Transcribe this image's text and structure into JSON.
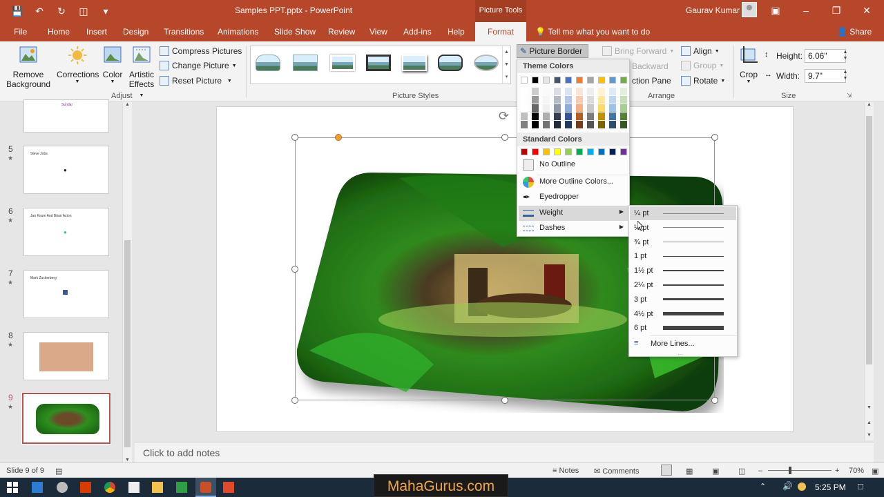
{
  "app": {
    "doc_title": "Samples PPT.pptx  -  PowerPoint",
    "context_tools": "Picture Tools",
    "user": "Gaurav Kumar"
  },
  "tabs": {
    "file": "File",
    "home": "Home",
    "insert": "Insert",
    "design": "Design",
    "transitions": "Transitions",
    "animations": "Animations",
    "slideshow": "Slide Show",
    "review": "Review",
    "view": "View",
    "addins": "Add-ins",
    "help": "Help",
    "format": "Format",
    "tell": "Tell me what you want to do",
    "share": "Share"
  },
  "ribbon": {
    "remove_bg_1": "Remove",
    "remove_bg_2": "Background",
    "corrections": "Corrections",
    "color": "Color",
    "artistic_1": "Artistic",
    "artistic_2": "Effects",
    "compress": "Compress Pictures",
    "change": "Change Picture",
    "reset": "Reset Picture",
    "adjust_label": "Adjust",
    "styles_label": "Picture Styles",
    "picture_border": "Picture Border",
    "bring_forward": "Bring Forward",
    "send_backward": "Backward",
    "selection_pane": "ction Pane",
    "align": "Align",
    "group": "Group",
    "rotate": "Rotate",
    "arrange_label": "Arrange",
    "crop": "Crop",
    "height_label": "Height:",
    "height_value": "6.06\"",
    "width_label": "Width:",
    "width_value": "9.7\"",
    "size_label": "Size"
  },
  "border_menu": {
    "theme_colors": "Theme Colors",
    "standard_colors": "Standard Colors",
    "no_outline": "No Outline",
    "more_colors": "More Outline Colors...",
    "eyedropper": "Eyedropper",
    "weight": "Weight",
    "dashes": "Dashes",
    "theme_row": [
      "#ffffff",
      "#000000",
      "#e7e6e6",
      "#44546a",
      "#4472c4",
      "#ed7d31",
      "#a5a5a5",
      "#ffc000",
      "#5b9bd5",
      "#70ad47"
    ],
    "standard_row": [
      "#c00000",
      "#ff0000",
      "#ffc000",
      "#ffff00",
      "#92d050",
      "#00b050",
      "#00b0f0",
      "#0070c0",
      "#002060",
      "#7030a0"
    ]
  },
  "weight_menu": {
    "items": [
      "¼ pt",
      "½ pt",
      "¾ pt",
      "1 pt",
      "1½ pt",
      "2¼ pt",
      "3 pt",
      "4½ pt",
      "6 pt"
    ],
    "more_lines": "More Lines..."
  },
  "slides": {
    "thumbs": [
      {
        "num": "",
        "text": "Sundar"
      },
      {
        "num": "5",
        "text": "Steve Jobs"
      },
      {
        "num": "6",
        "text": "Jan Koum And Brian Acton"
      },
      {
        "num": "7",
        "text": "Mark Zuckerberg"
      },
      {
        "num": "8",
        "text": ""
      },
      {
        "num": "9",
        "text": ""
      }
    ]
  },
  "notes_placeholder": "Click to add notes",
  "status": {
    "slide_info": "Slide 9 of 9",
    "notes": "Notes",
    "comments": "Comments",
    "zoom": "70%"
  },
  "taskbar": {
    "watermark": "MahaGurus.com",
    "clock": "5:25 PM"
  }
}
